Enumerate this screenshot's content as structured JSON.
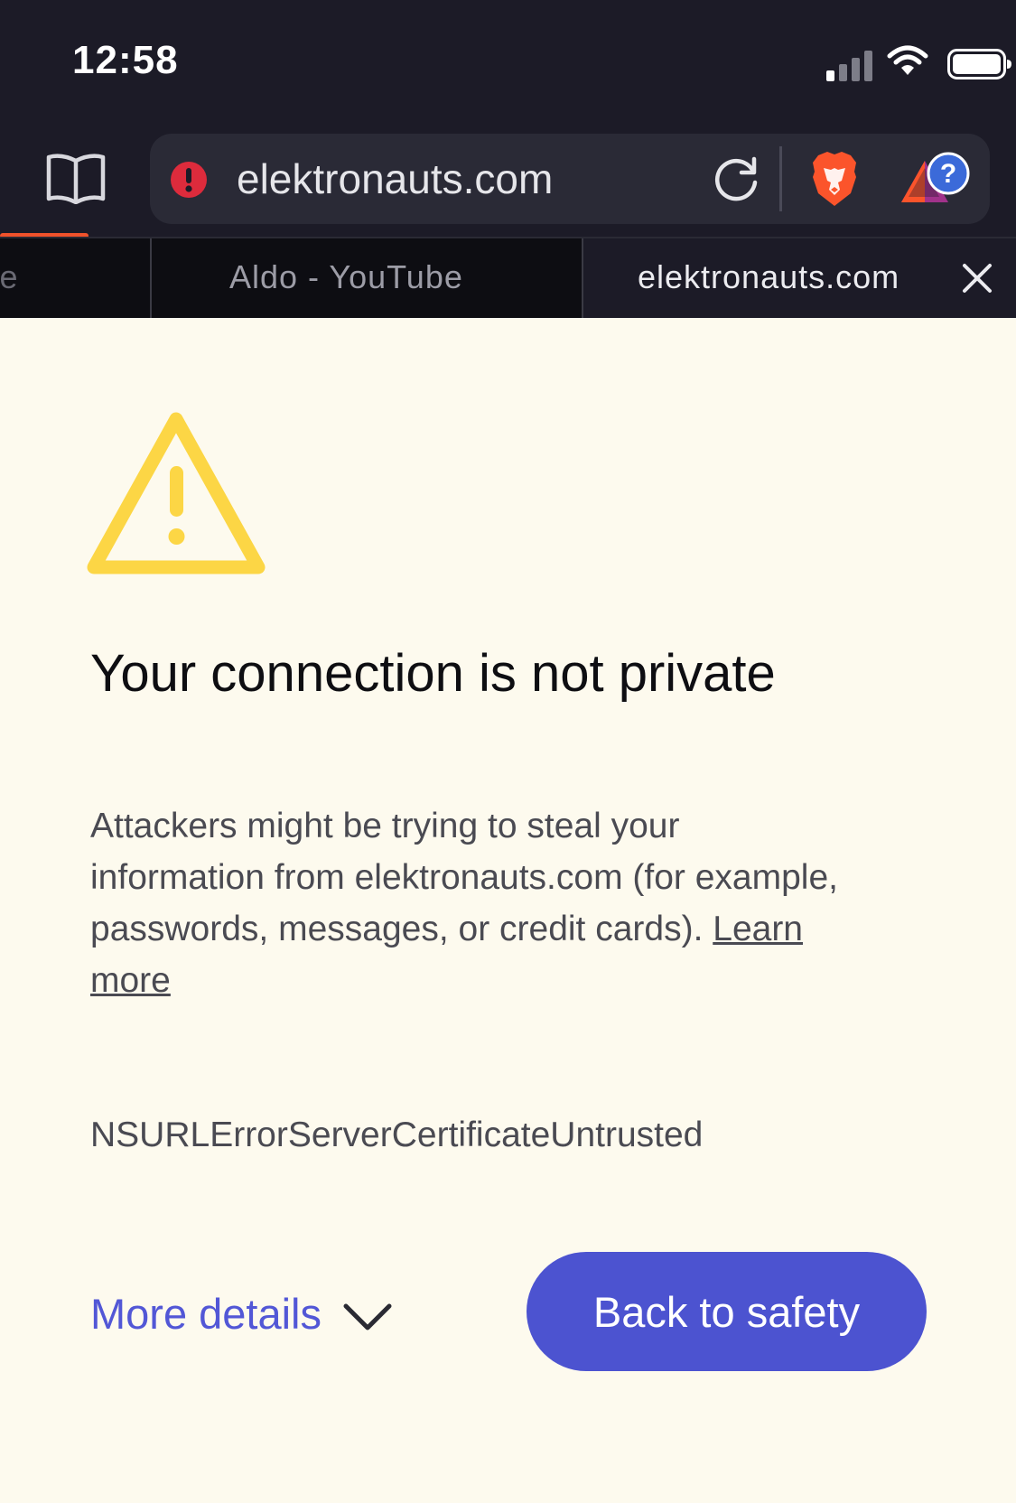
{
  "status_bar": {
    "time": "12:58",
    "icons": [
      "cellular-signal-icon",
      "wifi-icon",
      "battery-icon"
    ]
  },
  "toolbar": {
    "url": "elektronauts.com",
    "icons": [
      "bookmarks-book-icon",
      "security-warning-icon",
      "reload-icon",
      "brave-shields-lion-icon",
      "brave-rewards-icon"
    ]
  },
  "tabs": [
    {
      "label": "YouTube",
      "active": false
    },
    {
      "label": "Aldo - YouTube",
      "active": false
    },
    {
      "label": "elektronauts.com",
      "active": true
    }
  ],
  "interstitial": {
    "title": "Your connection is not private",
    "body": "Attackers might be trying to steal your information from elektronauts.com (for example, passwords, messages, or credit cards).",
    "learn_more": "Learn more",
    "error_code": "NSURLErrorServerCertificateUntrusted",
    "more_details": "More details",
    "back_button": "Back to safety"
  },
  "colors": {
    "toolbar_bg": "#1c1b27",
    "page_bg": "#fdfaee",
    "warning_yellow": "#fcd645",
    "accent_blue": "#4c53d0",
    "link_blue": "#5257d6",
    "tab_progress": "#f0522b",
    "brave_orange": "#fb542b"
  }
}
